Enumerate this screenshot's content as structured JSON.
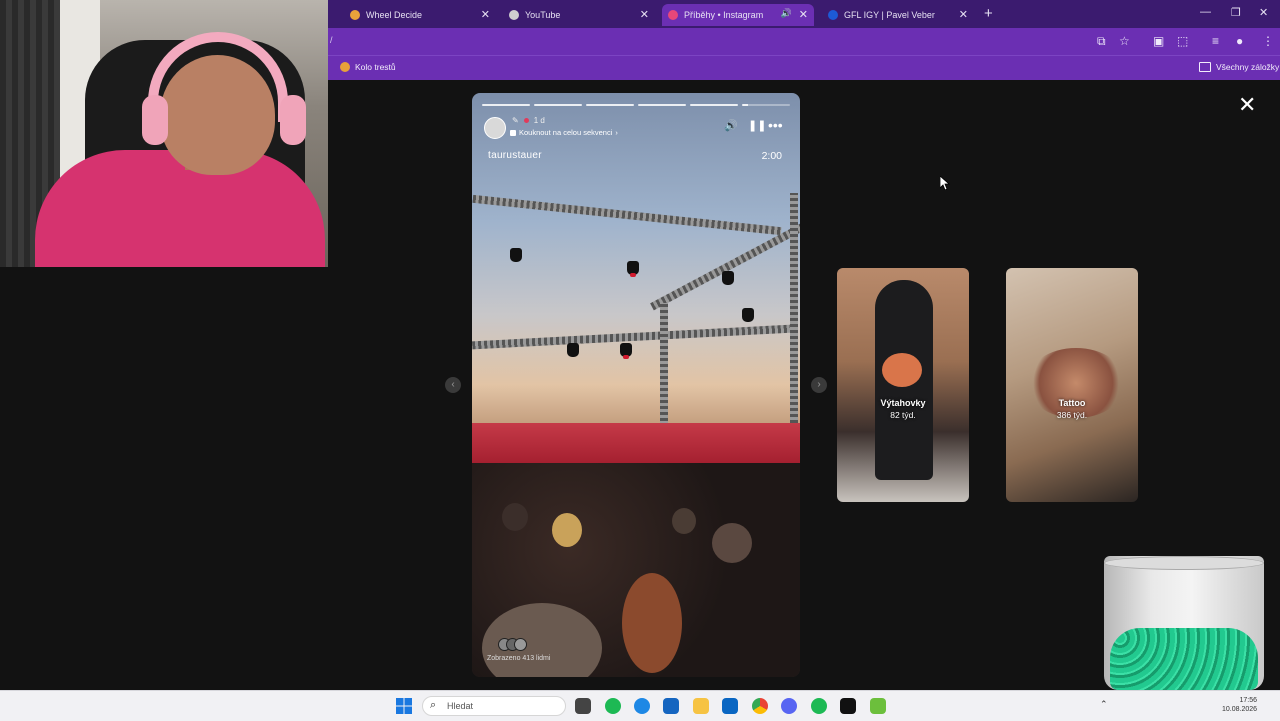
{
  "browser": {
    "tabs": [
      {
        "title": "Wheel Decide",
        "favicon_color": "#e9a23b"
      },
      {
        "title": "YouTube",
        "favicon_color": "#cfcfcf"
      },
      {
        "title": "Příběhy • Instagram",
        "favicon_color": "#e8477a"
      },
      {
        "title": "GFL IGY | Pavel Veber",
        "favicon_color": "#1d5ad6"
      }
    ],
    "address": "/",
    "bookmarks": {
      "item": "Kolo trestů",
      "all": "Všechny záložky"
    }
  },
  "story": {
    "age": "1 d",
    "sequence_link": "Kouknout na celou sekvenci",
    "username": "taurustauer",
    "duration": "2:00",
    "viewers": "Zobrazeno 413 lidmi"
  },
  "highlights": [
    {
      "title": "Výtahovky",
      "age": "82 týd."
    },
    {
      "title": "Tattoo",
      "age": "386 týd."
    }
  ],
  "taskbar": {
    "search_placeholder": "Hledat",
    "time": "17:56",
    "date": "10.08.2026"
  },
  "colors": {
    "tab_bar": "#3b1b6f",
    "chrome": "#6b2fb3",
    "viewer_bg": "#121212"
  }
}
